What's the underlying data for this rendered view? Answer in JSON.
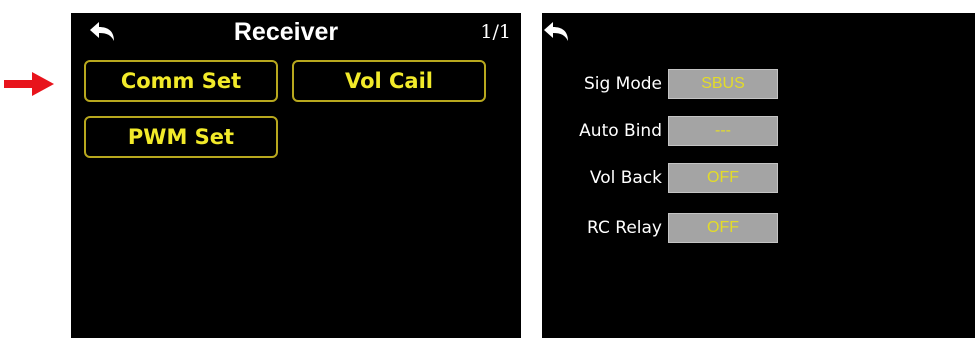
{
  "indicator": {
    "icon": "red-arrow-right-icon",
    "color": "#e8141c"
  },
  "receiver_menu": {
    "back_icon": "back-arrow-icon",
    "title": "Receiver",
    "page_indicator": "1/1",
    "buttons": [
      {
        "label": "Comm Set"
      },
      {
        "label": "Vol Cail"
      },
      {
        "label": "PWM Set"
      }
    ],
    "accent_color": "#f2ea2a"
  },
  "comm_settings": {
    "back_icon": "back-arrow-icon",
    "rows": [
      {
        "label": "Sig Mode",
        "value": "SBUS"
      },
      {
        "label": "Auto Bind",
        "value": "---"
      },
      {
        "label": "Vol Back",
        "value": "OFF"
      },
      {
        "label": "RC Relay",
        "value": "OFF"
      }
    ],
    "value_bg_color": "#a4a4a4",
    "value_text_color": "#e3dc28"
  }
}
